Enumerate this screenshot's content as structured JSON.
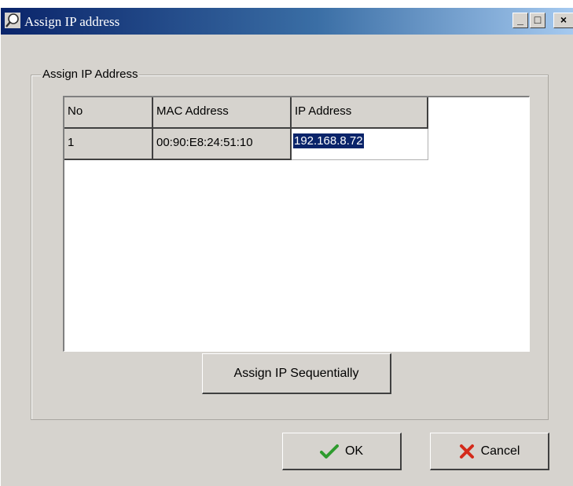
{
  "window": {
    "title": "Assign IP address",
    "minimize": "_",
    "maximize": "□",
    "close": "×"
  },
  "group": {
    "label": "Assign IP Address"
  },
  "table": {
    "columns": [
      "No",
      "MAC Address",
      "IP Address"
    ],
    "rows": [
      {
        "no": "1",
        "mac": "00:90:E8:24:51:10",
        "ip": "192.168.8.72"
      }
    ]
  },
  "buttons": {
    "assign_sequential": "Assign IP Sequentially",
    "ok": "OK",
    "cancel": "Cancel"
  },
  "icons": {
    "app": "magnifier-icon",
    "ok": "checkmark-icon",
    "cancel": "x-icon"
  },
  "colors": {
    "titlebar_start": "#0a246a",
    "titlebar_end": "#a6caf0",
    "selection": "#0a246a",
    "ok_check": "#2e9b2e",
    "cancel_x": "#d42a1a"
  }
}
